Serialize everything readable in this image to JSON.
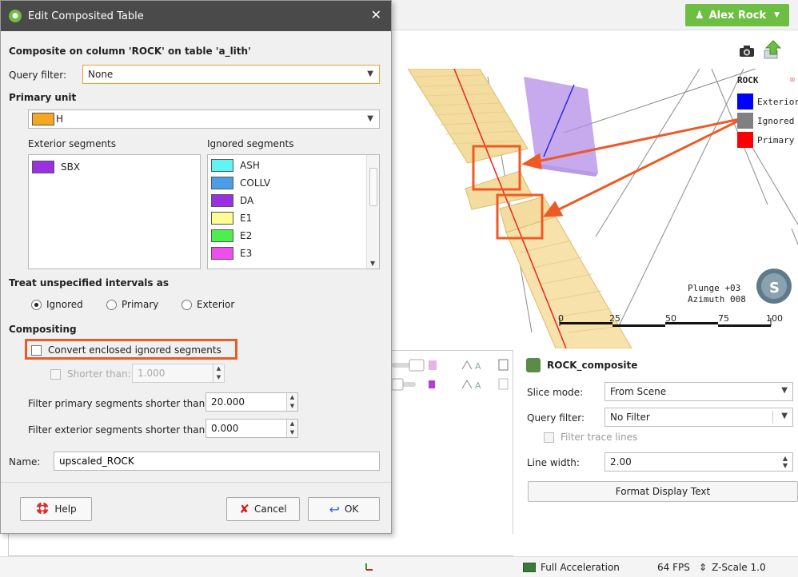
{
  "app": {
    "user_label": "Alex Rock",
    "accent": "#6fbe44"
  },
  "scene": {
    "legend": {
      "title": "ROCK",
      "items": [
        {
          "label": "Exterior",
          "color": "#0000ff"
        },
        {
          "label": "Ignored",
          "color": "#808080"
        },
        {
          "label": "Primary",
          "color": "#ff0000"
        }
      ]
    },
    "orientation": {
      "plunge": "Plunge +03",
      "azimuth": "Azimuth 008"
    },
    "scale_ticks": [
      "0",
      "25",
      "50",
      "75",
      "100"
    ]
  },
  "properties": {
    "title": "ROCK_composite",
    "slice_mode_label": "Slice mode:",
    "slice_mode_value": "From Scene",
    "query_filter_label": "Query filter:",
    "query_filter_value": "No Filter",
    "filter_trace_label": "Filter trace lines",
    "line_width_label": "Line width:",
    "line_width_value": "2.00",
    "format_button": "Format Display Text"
  },
  "status": {
    "acceleration": "Full Acceleration",
    "fps": "64 FPS",
    "zscale": "Z-Scale 1.0"
  },
  "dialog": {
    "title": "Edit Composited Table",
    "heading": "Composite on column 'ROCK' on table 'a_lith'",
    "query_filter_label": "Query filter:",
    "query_filter_value": "None",
    "primary_unit_label": "Primary unit",
    "primary_unit_value": "H",
    "primary_unit_color": "#f5a623",
    "exterior_label": "Exterior segments",
    "ignored_label": "Ignored segments",
    "exterior_items": [
      {
        "label": "SBX",
        "color": "#9b30e0"
      }
    ],
    "ignored_items": [
      {
        "label": "ASH",
        "color": "#5ef5f5"
      },
      {
        "label": "COLLV",
        "color": "#4a9ee8"
      },
      {
        "label": "DA",
        "color": "#9b30e0"
      },
      {
        "label": "E1",
        "color": "#fdfd96"
      },
      {
        "label": "E2",
        "color": "#4cf04c"
      },
      {
        "label": "E3",
        "color": "#f04cf0"
      }
    ],
    "treat_label": "Treat unspecified intervals as",
    "treat_options": [
      "Ignored",
      "Primary",
      "Exterior"
    ],
    "treat_selected": "Ignored",
    "compositing_label": "Compositing",
    "convert_label": "Convert enclosed ignored segments",
    "shorter_than_label": "Shorter than:",
    "shorter_than_value": "1.000",
    "filter_primary_label": "Filter primary segments shorter than:",
    "filter_primary_value": "20.000",
    "filter_exterior_label": "Filter exterior segments shorter than:",
    "filter_exterior_value": "0.000",
    "name_label": "Name:",
    "name_value": "upscaled_ROCK",
    "help_button": "Help",
    "cancel_button": "Cancel",
    "ok_button": "OK",
    "highlight_color": "#ee5a24"
  }
}
